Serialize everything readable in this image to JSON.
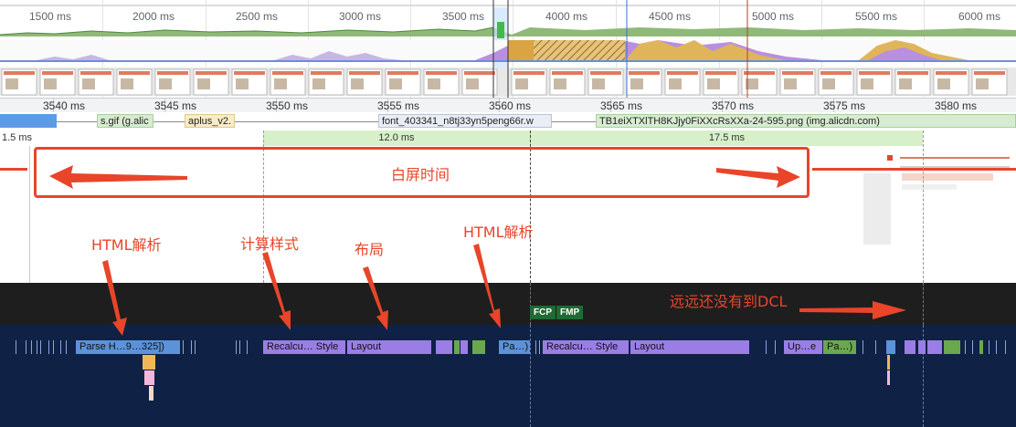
{
  "overview": {
    "ticks": [
      "1500 ms",
      "2000 ms",
      "2500 ms",
      "3000 ms",
      "3500 ms",
      "4000 ms",
      "4500 ms",
      "5000 ms",
      "5500 ms",
      "6000 ms"
    ]
  },
  "ruler": {
    "ticks": [
      "3540 ms",
      "3545 ms",
      "3550 ms",
      "3555 ms",
      "3560 ms",
      "3565 ms",
      "3570 ms",
      "3575 ms",
      "3580 ms"
    ]
  },
  "network": {
    "requests": [
      {
        "label": "",
        "color": "#5b9be6"
      },
      {
        "label": "s.gif (g.alic",
        "color": "#d6ecd0"
      },
      {
        "label": "aplus_v2.",
        "color": "#f9ebc8"
      },
      {
        "label": "font_403341_n8tj33yn5peng66r.w",
        "color": "#e9edf5"
      },
      {
        "label": "TB1eiXTXlTH8KJjy0FiXXcRsXXa-24-595.png (img.alicdn.com)",
        "color": "#d6ecd0"
      }
    ]
  },
  "frames": {
    "durations": [
      "1.5 ms",
      "12.0 ms",
      "17.5 ms"
    ]
  },
  "markers": {
    "fcp": "FCP",
    "fmp": "FMP"
  },
  "main": {
    "events": [
      {
        "label": "Parse H…9…325])",
        "color": "#5b92d9"
      },
      {
        "label": "Recalcu… Style",
        "color": "#9a7ee6"
      },
      {
        "label": "Layout",
        "color": "#9a7ee6"
      },
      {
        "label": "Pa…)",
        "color": "#5b92d9"
      },
      {
        "label": "Recalcu… Style",
        "color": "#9a7ee6"
      },
      {
        "label": "Layout",
        "color": "#9a7ee6"
      },
      {
        "label": "Up…e",
        "color": "#9a7ee6"
      },
      {
        "label": "Pa…)",
        "color": "#6aa84f"
      }
    ]
  },
  "annotations": {
    "white_screen": "白屏时间",
    "html_parse_1": "HTML解析",
    "calc_style": "计算样式",
    "layout": "布局",
    "html_parse_2": "HTML解析",
    "no_dcl": "远远还没有到DCL"
  },
  "colors": {
    "annotation": "#e8452a",
    "fcp": "#1e6b34",
    "fmp": "#1e6b34",
    "main_bg": "#0f2144"
  }
}
